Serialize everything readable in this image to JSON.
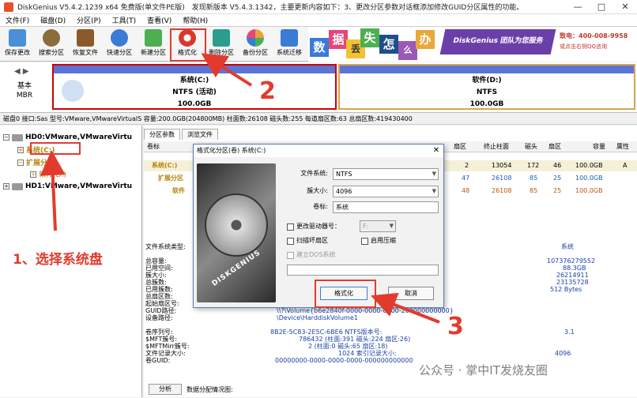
{
  "window": {
    "title": "DiskGenius V5.4.2.1239 x64 免费版(单文件PE版)　发现新版本 V5.4.3.1342，主要更新内容如下：3、更改分区参数对话框添加修改GUID分区属性的功能。",
    "min": "—",
    "max": "□",
    "close": "✕"
  },
  "menu": [
    "文件(F)",
    "磁盘(D)",
    "分区(P)",
    "工具(T)",
    "查看(V)",
    "帮助(H)"
  ],
  "toolbar": [
    {
      "label": "保存更改",
      "color": "#4a90d9",
      "icon": "save-icon"
    },
    {
      "label": "搜索分区",
      "color": "#8a6d3b",
      "icon": "search-icon"
    },
    {
      "label": "恢复文件",
      "color": "#8b5a2b",
      "icon": "recover-icon"
    },
    {
      "label": "快速分区",
      "color": "#3a7bd5",
      "icon": "quick-partition-icon"
    },
    {
      "label": "新建分区",
      "color": "#4caf50",
      "icon": "new-partition-icon"
    },
    {
      "label": "格式化",
      "color": "#d9372c",
      "icon": "format-icon"
    },
    {
      "label": "删除分区",
      "color": "#2a9d8f",
      "icon": "delete-icon"
    },
    {
      "label": "备份分区",
      "color": "#e9a23b",
      "icon": "backup-icon"
    },
    {
      "label": "系统迁移",
      "color": "#3a7bd5",
      "icon": "migrate-icon"
    }
  ],
  "banner": {
    "tiles": [
      {
        "text": "数",
        "color": "#3a7bd5"
      },
      {
        "text": "据",
        "color": "#e6457a"
      },
      {
        "text": "丢",
        "color": "#f1c232"
      },
      {
        "text": "失",
        "color": "#4caf50"
      },
      {
        "text": "怎",
        "color": "#1f4e8c"
      },
      {
        "text": "么",
        "color": "#9b59b6"
      },
      {
        "text": "办",
        "color": "#e8a83a"
      }
    ],
    "slogan": "DiskGenius 团队为您服务",
    "tel": "致电：400-008-9958",
    "qq": "或点击右侧QQ咨询"
  },
  "diskmap": {
    "nav": "◀ ▶",
    "type_line1": "基本",
    "type_line2": "MBR",
    "partitions": [
      {
        "name": "系统(C:)",
        "fs": "NTFS (活动)",
        "size": "100.0GB",
        "color": "#5b74d6"
      },
      {
        "name": "软件(D:)",
        "fs": "NTFS",
        "size": "100.0GB",
        "color": "#5b74d6"
      }
    ]
  },
  "diskinfo": "磁盘0 接口:Sas  型号:VMware,VMwareVirtualS  容量:200.0GB(204800MB)  柱面数:26108  磁头数:255  每道扇区数:63  总扇区数:419430400",
  "tree": {
    "hd0": "HD0:VMware,VMwareVirtu",
    "sys": "系统(C:)",
    "ext": "扩展分区",
    "soft": "软件(D:)",
    "hd1": "HD1:VMware,VMwareVirtu"
  },
  "tabs": [
    "分区参数",
    "浏览文件"
  ],
  "table": {
    "headers": [
      "卷标",
      "扇区",
      "终止柱面",
      "磁头",
      "扇区",
      "容量",
      "属性"
    ],
    "rows": [
      {
        "label": "系统(C:)",
        "sec": "2",
        "endcyl": "13054",
        "head": "172",
        "sec2": "46",
        "cap": "100.0GB",
        "attr": "A"
      },
      {
        "label": "扩展分区",
        "sec": "47",
        "endcyl": "26108",
        "head": "85",
        "sec2": "25",
        "cap": "100.0GB",
        "attr": ""
      },
      {
        "label": "软件",
        "sec": "48",
        "endcyl": "26108",
        "head": "85",
        "sec2": "25",
        "cap": "100.0GB",
        "attr": ""
      }
    ]
  },
  "details": {
    "labels": [
      "文件系统类型:",
      "总容量:",
      "已用空间:",
      "簇大小:",
      "总簇数:",
      "已用簇数:",
      "总扇区数:",
      "起始扇区号:",
      "GUID路径:",
      "设备路径:",
      "卷序列号:",
      "$MFT簇号:",
      "$MFTMirr簇号:",
      "文件记录大小:",
      "卷GUID:"
    ],
    "fs_header": "系统",
    "values": [
      "107376279552",
      "88.3GB",
      "26214911",
      "23135728",
      "512 Bytes"
    ],
    "guid": "\\\\?\\Volume{b6e2840f-0000-0000-0000-200000000000}",
    "device": "\\Device\\HarddiskVolume1",
    "serial": "8B2E-5C83-2E5C-6BE6     NTFS版本号:",
    "serial_v": "3.1",
    "mft": "786432 (柱面:391 磁头:224 扇区:26)",
    "mftmirr": "2 (柱面:0 磁头:65 扇区:18)",
    "record": "1024      索引记录大小:",
    "record_v": "4096",
    "volguid": "00000000-0000-0000-0000-000000000000",
    "analyze": "分析",
    "alloc": "数据分配情况图:"
  },
  "dialog": {
    "title": "格式化分区(卷) 系统(C:)",
    "close": "✕",
    "brand": "DISKGENIUS",
    "fs_label": "文件系统:",
    "fs_value": "NTFS",
    "cluster_label": "簇大小:",
    "cluster_value": "4096",
    "vol_label": "卷标:",
    "vol_value": "系统",
    "chk_drive": "更改驱动器号：",
    "drive_value": "F:",
    "chk_scan": "扫描坏扇区",
    "chk_compress": "启用压缩",
    "chk_dos": "建立DOS系统",
    "btn_format": "格式化",
    "btn_cancel": "取消"
  },
  "annotations": {
    "step1": "1、选择系统盘",
    "step2": "2",
    "step3": "3"
  },
  "watermark": "公众号 · 掌中IT发烧友圈"
}
